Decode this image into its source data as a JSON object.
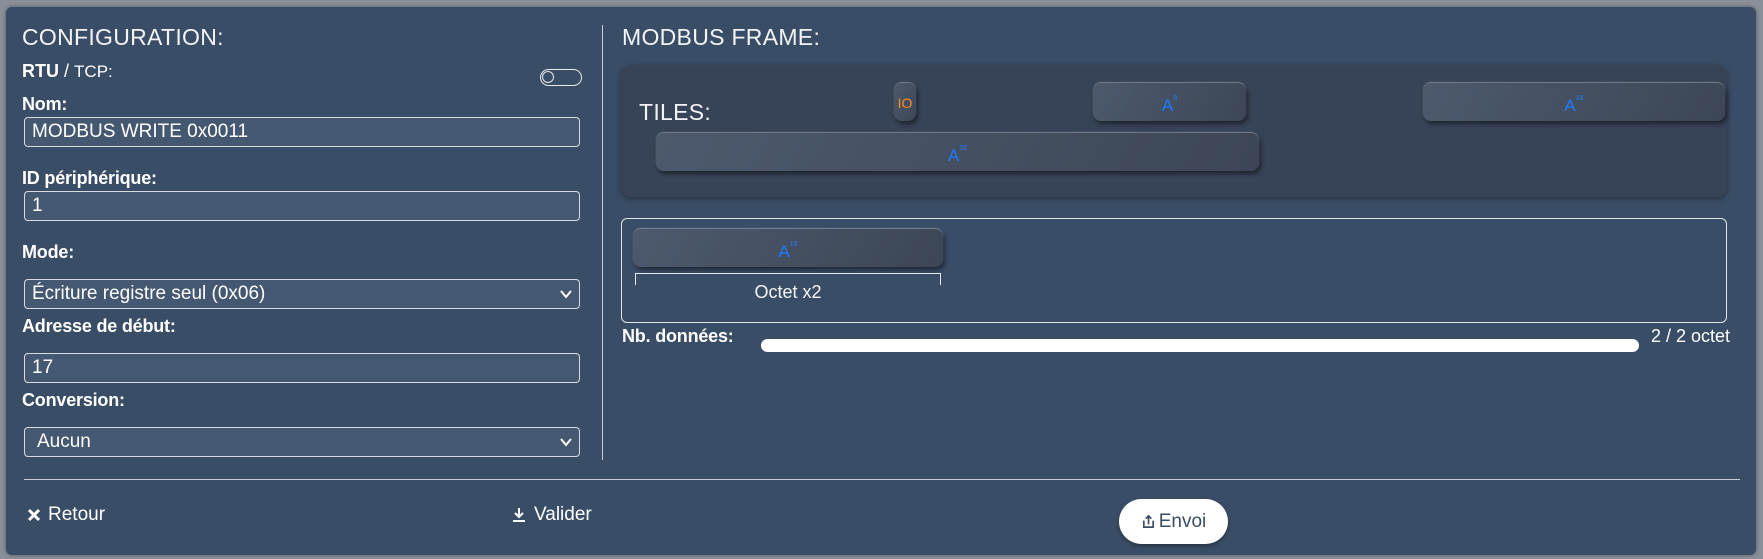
{
  "config": {
    "title": "CONFIGURATION:",
    "protocol_rtu": "RTU",
    "protocol_sep": "/",
    "protocol_tcp": "TCP:",
    "name_label": "Nom:",
    "name_value": "MODBUS WRITE 0x0011",
    "device_id_label": "ID périphérique:",
    "device_id_value": "1",
    "mode_label": "Mode:",
    "mode_value": "Écriture registre seul (0x06)",
    "start_address_label": "Adresse de début:",
    "start_address_value": "17",
    "conversion_label": "Conversion:",
    "conversion_value": "Aucun"
  },
  "frame": {
    "title": "MODBUS FRAME:",
    "tiles_label": "TILES:",
    "tiles": [
      {
        "kind": "io",
        "text": "IO"
      },
      {
        "kind": "analog",
        "text": "A",
        "sup": "8"
      },
      {
        "kind": "analog",
        "text": "A",
        "sup": "16"
      },
      {
        "kind": "analog",
        "text": "A",
        "sup": "32"
      }
    ],
    "frame_tile": {
      "text": "A",
      "sup": "16"
    },
    "octet_label": "Octet x2",
    "data_count_label": "Nb. données:",
    "data_count_progress": 1.0,
    "data_count_value": "2 / 2 octet"
  },
  "footer": {
    "back_label": "Retour",
    "validate_label": "Valider",
    "send_label": "Envoi"
  },
  "colors": {
    "panel": "#3a4d66",
    "accent_blue": "#1e7bff",
    "accent_orange": "#ff8c1a"
  }
}
